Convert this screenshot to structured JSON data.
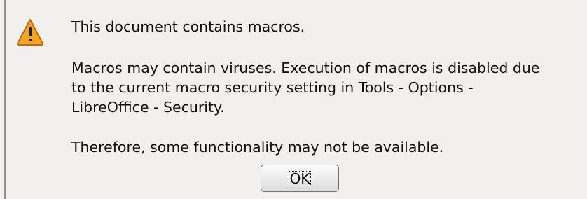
{
  "dialog": {
    "icon": "warning-icon",
    "title": "This document contains macros.",
    "message_lines": [
      "Macros may contain viruses. Execution of macros is disabled due",
      "to the current macro security setting in Tools - Options -",
      "LibreOffice - Security."
    ],
    "note": "Therefore, some functionality may not be available.",
    "ok_label": "OK"
  },
  "colors": {
    "background": "#f1f0ee",
    "warning_fill": "#f5a524",
    "warning_stroke": "#bf6a00",
    "text": "#101010"
  }
}
